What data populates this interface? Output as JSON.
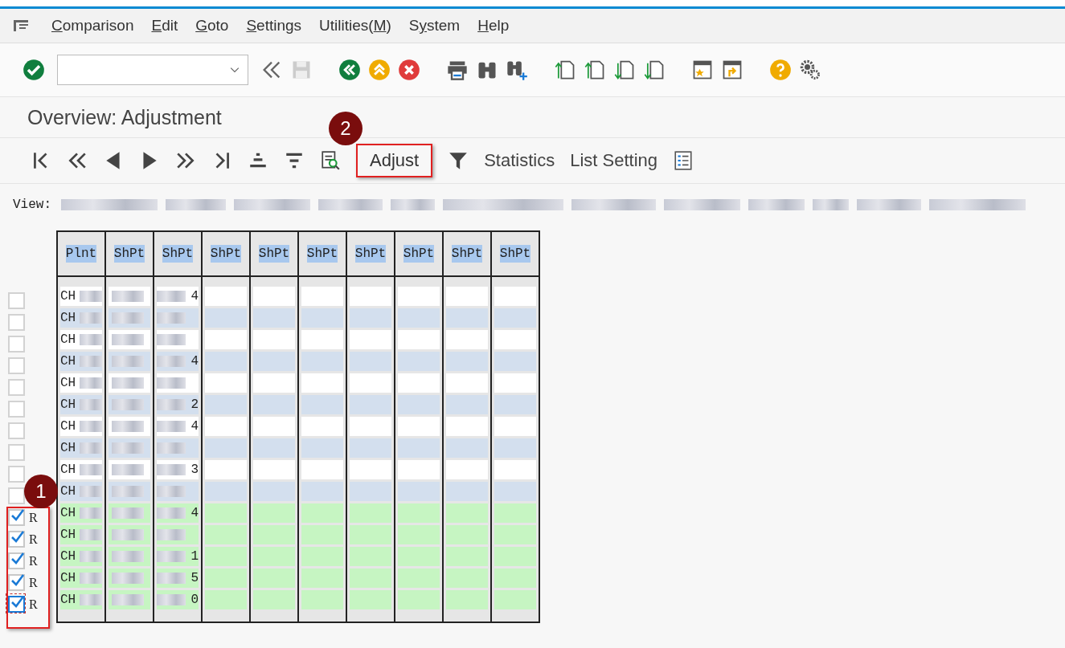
{
  "menu": [
    {
      "key": "C",
      "rest": "omparison"
    },
    {
      "key": "E",
      "rest": "dit"
    },
    {
      "key": "G",
      "rest": "oto"
    },
    {
      "key": "S",
      "rest": "ettings"
    },
    {
      "lead": "Utilities(",
      "key": "M",
      "rest": ")"
    },
    {
      "lead": "S",
      "key": "y",
      "rest": "stem"
    },
    {
      "key": "H",
      "rest": "elp"
    }
  ],
  "title": "Overview: Adjustment",
  "app_toolbar": {
    "adjust": {
      "label": "Adjust",
      "callout": "2"
    },
    "statistics": "Statistics",
    "list_setting": "List Setting"
  },
  "view": {
    "label": "View:"
  },
  "table": {
    "callout": "1",
    "columns": [
      "Plnt",
      "ShPt",
      "ShPt",
      "ShPt",
      "ShPt",
      "ShPt",
      "ShPt",
      "ShPt",
      "ShPt",
      "ShPt"
    ],
    "rows": [
      {
        "checked": false,
        "focused": false,
        "plant": "CH",
        "digit": "4"
      },
      {
        "checked": false,
        "focused": false,
        "plant": "CH"
      },
      {
        "checked": false,
        "focused": false,
        "plant": "CH"
      },
      {
        "checked": false,
        "focused": false,
        "plant": "CH",
        "digit": "4"
      },
      {
        "checked": false,
        "focused": false,
        "plant": "CH"
      },
      {
        "checked": false,
        "focused": false,
        "plant": "CH",
        "digit": "2"
      },
      {
        "checked": false,
        "focused": false,
        "plant": "CH",
        "digit": "4"
      },
      {
        "checked": false,
        "focused": false,
        "plant": "CH"
      },
      {
        "checked": false,
        "focused": false,
        "plant": "CH",
        "digit": "3"
      },
      {
        "checked": false,
        "focused": false,
        "plant": "CH"
      },
      {
        "checked": true,
        "focused": false,
        "flag": "R",
        "plant": "CH",
        "digit": "4"
      },
      {
        "checked": true,
        "focused": false,
        "flag": "R",
        "plant": "CH"
      },
      {
        "checked": true,
        "focused": false,
        "flag": "R",
        "plant": "CH",
        "digit": "1"
      },
      {
        "checked": true,
        "focused": false,
        "flag": "R",
        "plant": "CH",
        "digit": "5"
      },
      {
        "checked": true,
        "focused": true,
        "flag": "R",
        "plant": "CH",
        "digit": "0"
      }
    ]
  }
}
